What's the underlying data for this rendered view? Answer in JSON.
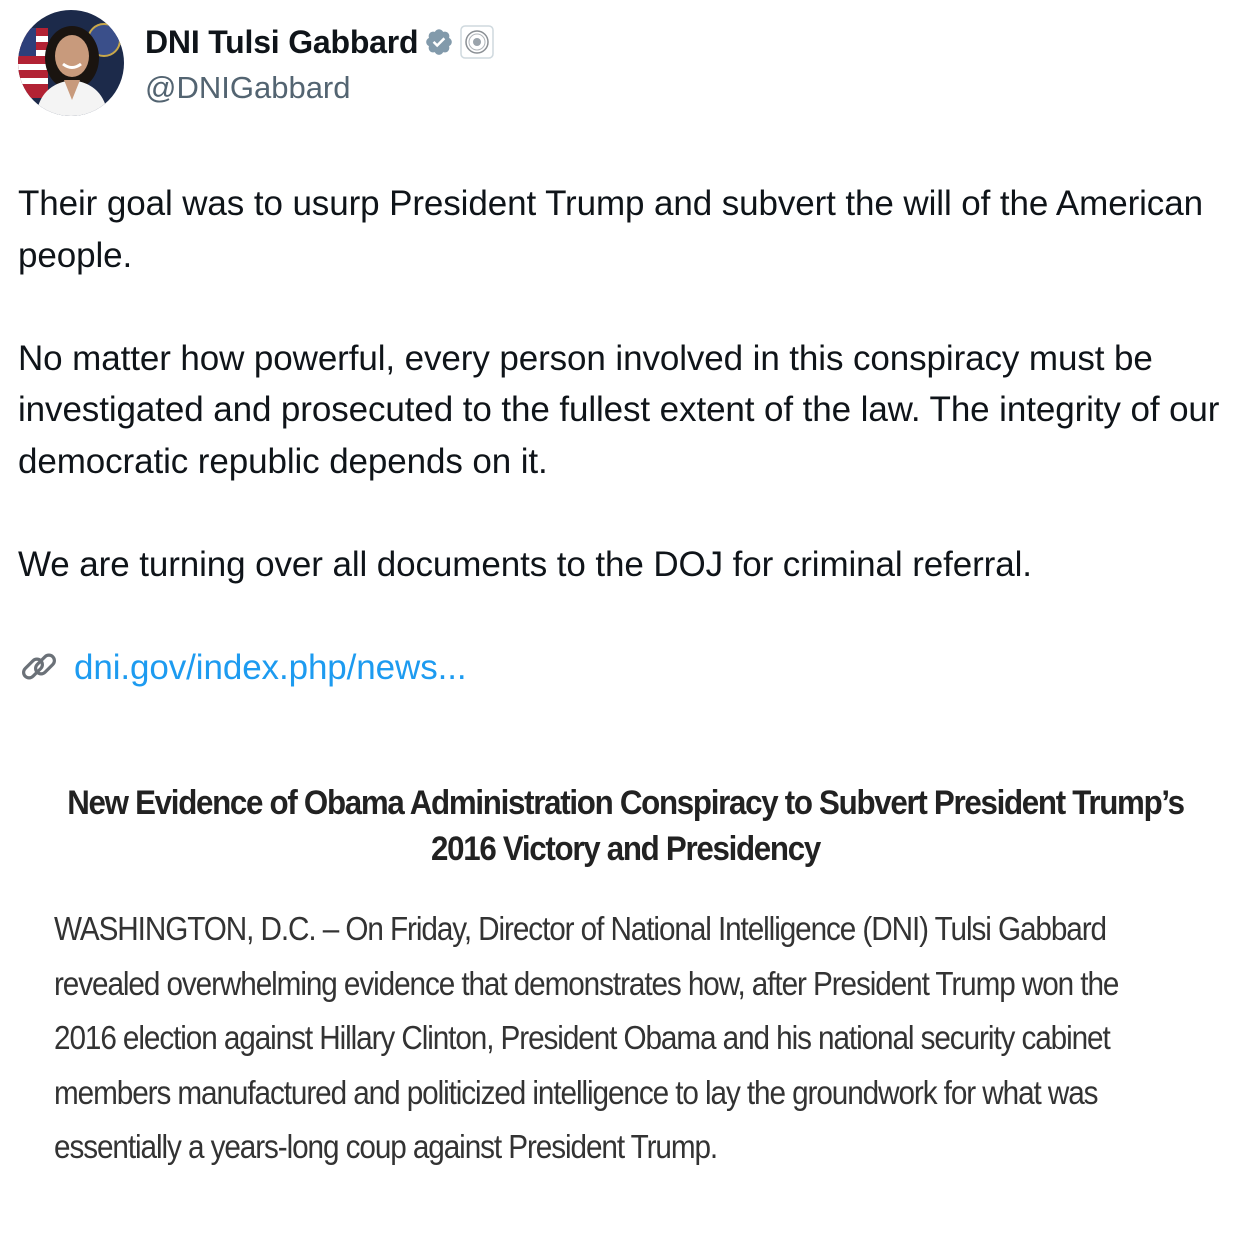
{
  "tweet": {
    "author": {
      "display_name": "DNI Tulsi Gabbard",
      "handle": "@DNIGabbard",
      "verified_icon": "verified-badge-icon",
      "affiliation_icon": "government-seal-icon",
      "accent_color": "#829aab"
    },
    "paragraphs": [
      "Their goal was to usurp President Trump and subvert the will of the American people.",
      "No matter how powerful, every person involved in this conspiracy must be investigated and prosecuted to the fullest extent of the law. The integrity of our democratic republic depends on it.",
      "We are turning over all documents to the DOJ for criminal referral."
    ],
    "link": {
      "icon": "link-icon",
      "text": "dni.gov/index.php/news...",
      "color": "#1d9bf0"
    },
    "attached_image": {
      "title": "New Evidence of Obama Administration Conspiracy to Subvert President Trump’s 2016 Victory and Presidency",
      "body": "WASHINGTON, D.C. – On Friday, Director of National Intelligence (DNI) Tulsi Gabbard revealed overwhelming evidence that demonstrates how, after President Trump won the 2016 election against Hillary Clinton, President Obama and his national security cabinet members manufactured and politicized intelligence to lay the groundwork for what was essentially a years-long coup against President Trump."
    }
  }
}
